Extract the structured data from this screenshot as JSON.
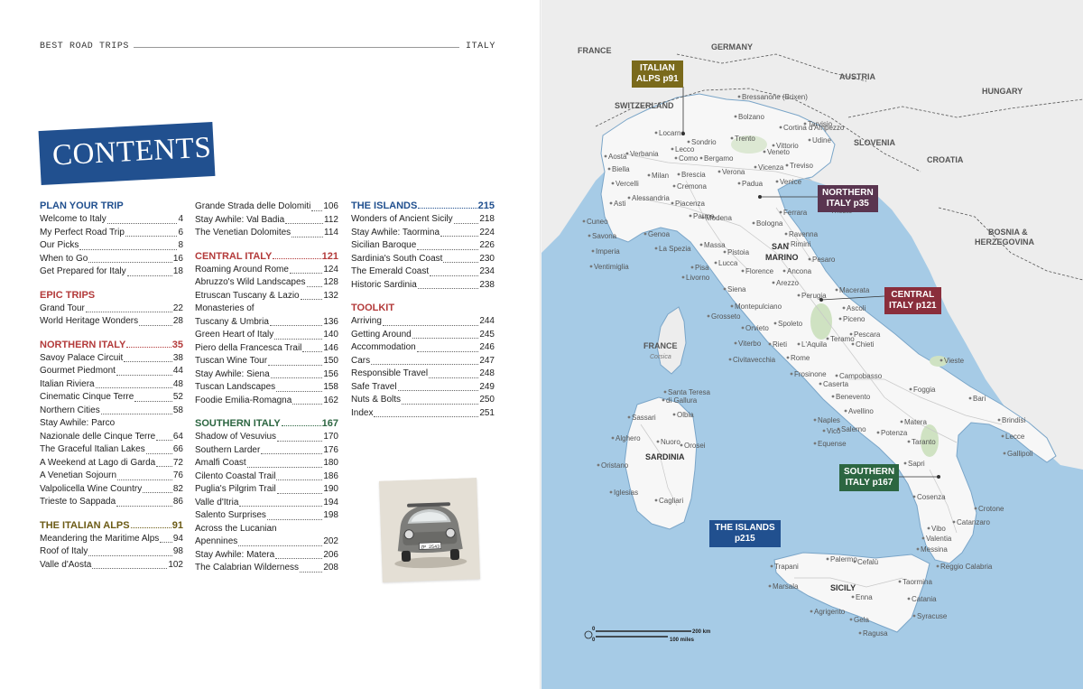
{
  "header": {
    "left": "BEST ROAD TRIPS",
    "right": "ITALY"
  },
  "contents_title": "CONTENTS",
  "toc": {
    "col1": [
      {
        "type": "section",
        "label": "PLAN YOUR TRIP",
        "page": "",
        "color": "#21508f"
      },
      {
        "type": "entry",
        "label": "Welcome to Italy",
        "page": "4"
      },
      {
        "type": "entry",
        "label": "My Perfect Road Trip",
        "page": "6"
      },
      {
        "type": "entry",
        "label": "Our Picks",
        "page": "8"
      },
      {
        "type": "entry",
        "label": "When to Go",
        "page": "16"
      },
      {
        "type": "entry",
        "label": "Get Prepared for Italy",
        "page": "18"
      },
      {
        "type": "section",
        "label": "EPIC TRIPS",
        "page": "",
        "color": "#b33a3a"
      },
      {
        "type": "entry",
        "label": "Grand Tour",
        "page": "22"
      },
      {
        "type": "entry",
        "label": "World Heritage Wonders",
        "page": "28"
      },
      {
        "type": "section",
        "label": "NORTHERN ITALY",
        "page": "35",
        "color": "#b33a3a"
      },
      {
        "type": "entry",
        "label": "Savoy Palace Circuit",
        "page": "38"
      },
      {
        "type": "entry",
        "label": "Gourmet Piedmont",
        "page": "44"
      },
      {
        "type": "entry",
        "label": "Italian Riviera",
        "page": "48"
      },
      {
        "type": "entry",
        "label": "Cinematic Cinque Terre",
        "page": "52"
      },
      {
        "type": "entry",
        "label": "Northern Cities",
        "page": "58"
      },
      {
        "type": "entry2",
        "label": "Stay Awhile: Parco",
        "label2": "Nazionale delle Cinque Terre",
        "page": "64"
      },
      {
        "type": "entry",
        "label": "The Graceful Italian Lakes",
        "page": "66"
      },
      {
        "type": "entry",
        "label": "A Weekend at Lago di Garda",
        "page": "72"
      },
      {
        "type": "entry",
        "label": "A Venetian Sojourn",
        "page": "76"
      },
      {
        "type": "entry",
        "label": "Valpolicella Wine Country",
        "page": "82"
      },
      {
        "type": "entry",
        "label": "Trieste to Sappada",
        "page": "86"
      },
      {
        "type": "section",
        "label": "THE ITALIAN ALPS",
        "page": "91",
        "color": "#6b5a14"
      },
      {
        "type": "entry",
        "label": "Meandering the Maritime Alps",
        "page": "94"
      },
      {
        "type": "entry",
        "label": "Roof of Italy",
        "page": "98"
      },
      {
        "type": "entry",
        "label": "Valle d'Aosta",
        "page": "102"
      }
    ],
    "col2": [
      {
        "type": "entry",
        "label": "Grande Strada delle Dolomiti",
        "page": "106"
      },
      {
        "type": "entry",
        "label": "Stay Awhile: Val Badia",
        "page": "112"
      },
      {
        "type": "entry",
        "label": "The Venetian Dolomites",
        "page": "114"
      },
      {
        "type": "section",
        "label": "CENTRAL ITALY",
        "page": "121",
        "color": "#b33a3a"
      },
      {
        "type": "entry",
        "label": "Roaming Around Rome",
        "page": "124"
      },
      {
        "type": "entry",
        "label": "Abruzzo's Wild Landscapes",
        "page": "128"
      },
      {
        "type": "entry",
        "label": "Etruscan Tuscany & Lazio",
        "page": "132"
      },
      {
        "type": "entry2",
        "label": "Monasteries of",
        "label2": "Tuscany & Umbria",
        "page": "136"
      },
      {
        "type": "entry",
        "label": "Green Heart of Italy",
        "page": "140"
      },
      {
        "type": "entry",
        "label": "Piero della Francesca Trail",
        "page": "146"
      },
      {
        "type": "entry",
        "label": "Tuscan Wine Tour",
        "page": "150"
      },
      {
        "type": "entry",
        "label": "Stay Awhile: Siena",
        "page": "156"
      },
      {
        "type": "entry",
        "label": "Tuscan Landscapes",
        "page": "158"
      },
      {
        "type": "entry",
        "label": "Foodie Emilia-Romagna",
        "page": "162"
      },
      {
        "type": "section",
        "label": "SOUTHERN ITALY",
        "page": "167",
        "color": "#2c6641"
      },
      {
        "type": "entry",
        "label": "Shadow of Vesuvius",
        "page": "170"
      },
      {
        "type": "entry",
        "label": "Southern Larder",
        "page": "176"
      },
      {
        "type": "entry",
        "label": "Amalfi Coast",
        "page": "180"
      },
      {
        "type": "entry",
        "label": "Cilento Coastal Trail",
        "page": "186"
      },
      {
        "type": "entry",
        "label": "Puglia's Pilgrim Trail",
        "page": "190"
      },
      {
        "type": "entry",
        "label": "Valle d'Itria",
        "page": "194"
      },
      {
        "type": "entry",
        "label": "Salento Surprises",
        "page": "198"
      },
      {
        "type": "entry2",
        "label": "Across the Lucanian",
        "label2": "Apennines",
        "page": "202"
      },
      {
        "type": "entry",
        "label": "Stay Awhile: Matera",
        "page": "206"
      },
      {
        "type": "entry",
        "label": "The Calabrian Wilderness",
        "page": "208"
      }
    ],
    "col3": [
      {
        "type": "section",
        "label": "THE ISLANDS",
        "page": "215",
        "color": "#21508f"
      },
      {
        "type": "entry",
        "label": "Wonders of Ancient Sicily",
        "page": "218"
      },
      {
        "type": "entry",
        "label": "Stay Awhile: Taormina",
        "page": "224"
      },
      {
        "type": "entry",
        "label": "Sicilian Baroque",
        "page": "226"
      },
      {
        "type": "entry",
        "label": "Sardinia's South Coast",
        "page": "230"
      },
      {
        "type": "entry",
        "label": "The Emerald Coast",
        "page": "234"
      },
      {
        "type": "entry",
        "label": "Historic Sardinia",
        "page": "238"
      },
      {
        "type": "section",
        "label": "TOOLKIT",
        "page": "",
        "color": "#b33a3a"
      },
      {
        "type": "entry",
        "label": "Arriving",
        "page": "244"
      },
      {
        "type": "entry",
        "label": "Getting Around",
        "page": "245"
      },
      {
        "type": "entry",
        "label": "Accommodation",
        "page": "246"
      },
      {
        "type": "entry",
        "label": "Cars",
        "page": "247"
      },
      {
        "type": "entry",
        "label": "Responsible Travel",
        "page": "248"
      },
      {
        "type": "entry",
        "label": "Safe Travel",
        "page": "249"
      },
      {
        "type": "entry",
        "label": "Nuts & Bolts",
        "page": "250"
      },
      {
        "type": "entry",
        "label": "Index",
        "page": "251"
      }
    ]
  },
  "photo": {
    "plate": "ZP 2543"
  },
  "map": {
    "countries": {
      "france": "FRANCE",
      "germany": "GERMANY",
      "austria": "AUSTRIA",
      "hungary": "HUNGARY",
      "switzerland": "SWITZERLAND",
      "slovenia": "SLOVENIA",
      "croatia": "CROATIA",
      "bosnia1": "BOSNIA &",
      "bosnia2": "HERZEGOVINA",
      "sanmarino1": "SAN",
      "sanmarino2": "MARINO",
      "france_corsica": "FRANCE",
      "corsica": "Corsica",
      "sardinia": "SARDINIA",
      "sicily": "SICILY"
    },
    "badges": {
      "alps": [
        "ITALIAN",
        "ALPS p91"
      ],
      "northern": [
        "NORTHERN",
        "ITALY p35"
      ],
      "central": [
        "CENTRAL",
        "ITALY p121"
      ],
      "southern": [
        "SOUTHERN",
        "ITALY p167"
      ],
      "islands": [
        "THE ISLANDS",
        "p215"
      ]
    },
    "badge_colors": {
      "alps": "#7a6a1c",
      "northern": "#5a3550",
      "central": "#8a2e3c",
      "southern": "#2c6641",
      "islands": "#21508f"
    },
    "scale": {
      "zero": "0",
      "km": "200 km",
      "miles": "100 miles"
    },
    "cities": [
      "Bressanone (Brixen)",
      "Bolzano",
      "Tarvisio",
      "Cortina d'Ampezzo",
      "Udine",
      "Trento",
      "Vittorio",
      "Veneto",
      "Locarno",
      "Sondrio",
      "Lecco",
      "Como",
      "Bergamo",
      "Aosta",
      "Verbania",
      "Biella",
      "Milan",
      "Brescia",
      "Verona",
      "Vicenza",
      "Treviso",
      "Vercelli",
      "Cremona",
      "Padua",
      "Venice",
      "Trieste",
      "Asti",
      "Alessandria",
      "Piacenza",
      "Parma",
      "Modena",
      "Ferrara",
      "Cuneo",
      "Genoa",
      "Bologna",
      "Ravenna",
      "Savona",
      "La Spezia",
      "Massa",
      "Pistoia",
      "Rimini",
      "Imperia",
      "Ventimiglia",
      "Lucca",
      "Florence",
      "Pesaro",
      "Pisa",
      "Ancona",
      "Livorno",
      "Siena",
      "Arezzo",
      "Perugia",
      "Macerata",
      "Grosseto",
      "Montepulciano",
      "Ascoli",
      "Piceno",
      "Orvieto",
      "Teramo",
      "Spoleto",
      "Pescara",
      "Viterbo",
      "Rieti",
      "L'Aquila",
      "Chieti",
      "Civitavecchia",
      "Rome",
      "Vieste",
      "Frosinone",
      "Campobasso",
      "Foggia",
      "Caserta",
      "Benevento",
      "Bari",
      "Naples",
      "Avellino",
      "Matera",
      "Brindisi",
      "Salerno",
      "Potenza",
      "Vico",
      "Equense",
      "Taranto",
      "Lecce",
      "Gallipoli",
      "Sapri",
      "Cosenza",
      "Crotone",
      "Catanzaro",
      "Vibo",
      "Valentia",
      "Messina",
      "Reggio Calabria",
      "Trapani",
      "Palermo",
      "Cefalù",
      "Taormina",
      "Marsala",
      "Enna",
      "Catania",
      "Agrigento",
      "Gela",
      "Syracuse",
      "Ragusa",
      "Santa Teresa",
      "di Gallura",
      "Sassari",
      "Olbia",
      "Alghero",
      "Nuoro",
      "Orosei",
      "Oristano",
      "Iglesias",
      "Cagliari"
    ]
  }
}
